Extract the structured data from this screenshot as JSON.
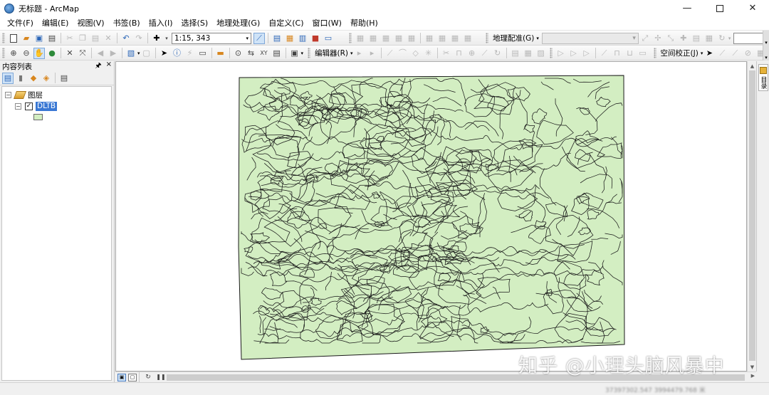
{
  "window": {
    "title": "无标题 - ArcMap",
    "minimize_glyph": "—",
    "close_glyph": "✕"
  },
  "menu": [
    "文件(F)",
    "编辑(E)",
    "视图(V)",
    "书签(B)",
    "插入(I)",
    "选择(S)",
    "地理处理(G)",
    "自定义(C)",
    "窗口(W)",
    "帮助(H)"
  ],
  "toolbar": {
    "scale_value": "1:15, 343",
    "georef_label": "地理配准(G)",
    "editor_label": "编辑器(R)",
    "spatial_adjust_label": "空间校正(J)"
  },
  "toc": {
    "title": "内容列表",
    "pin_glyph": "🖈",
    "close_glyph": "×",
    "root_label": "图层",
    "layers": [
      {
        "name": "DLTB",
        "visible": true,
        "symbol_color": "#d3eec2"
      }
    ]
  },
  "right_dock": {
    "tab_label": "目录"
  },
  "map": {
    "fill_color": "#d3eec2",
    "line_color": "#1a1a1a"
  },
  "status": {
    "coordinates": "37397302.547  3994479.768 米"
  },
  "watermark": "知乎 @小理头脑风暴中"
}
